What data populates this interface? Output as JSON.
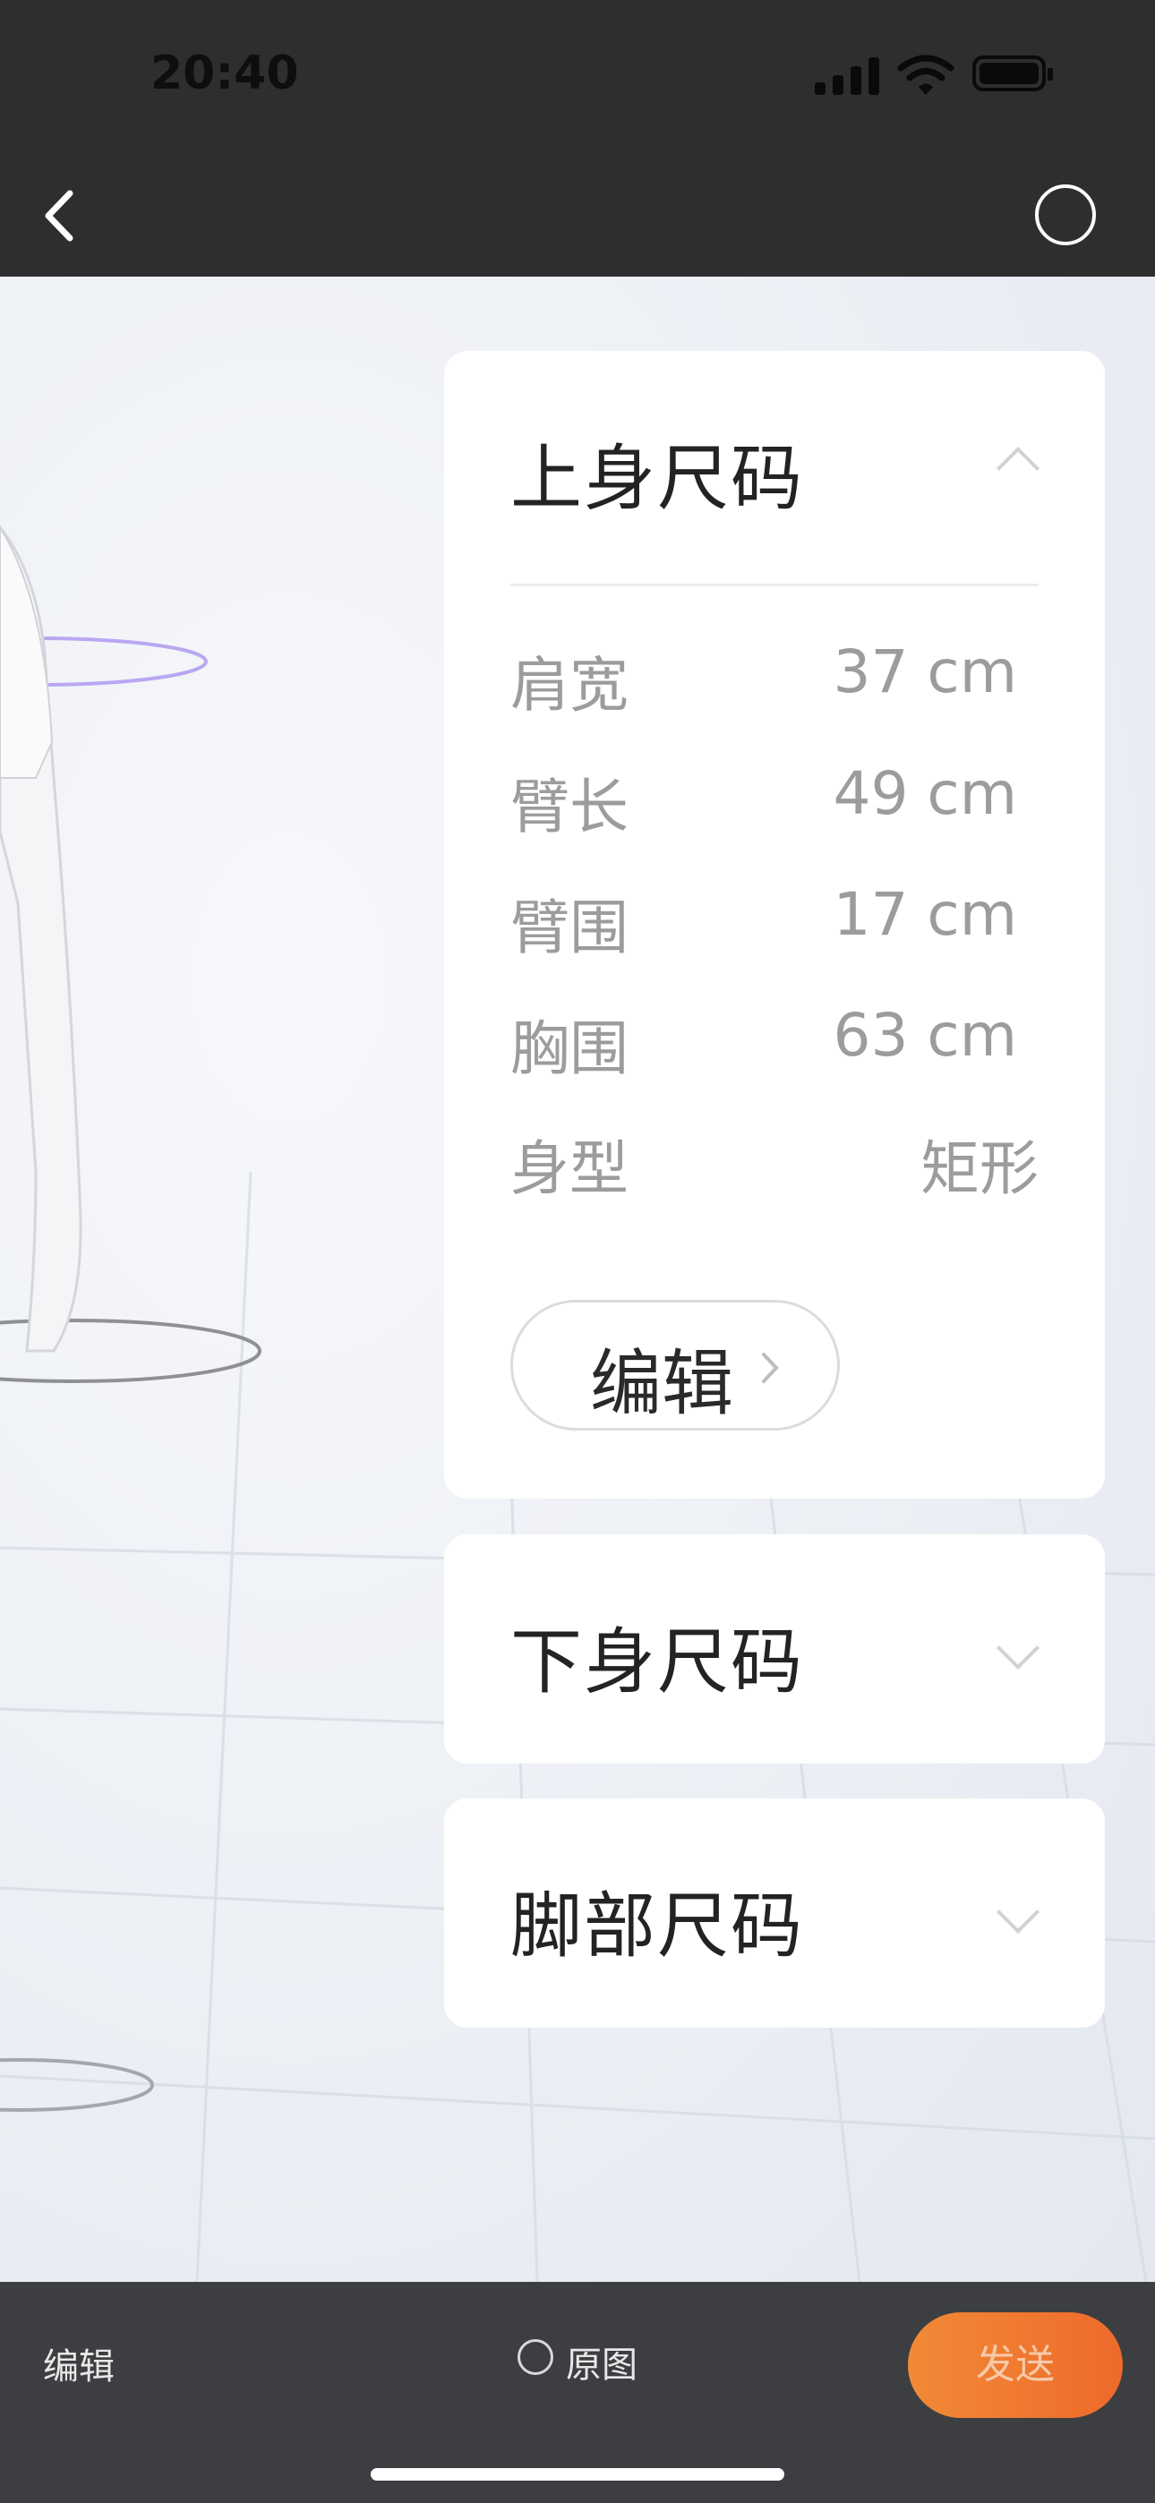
{
  "status_bar": {
    "time": "20:40"
  },
  "nav": {
    "back_icon": "chevron-left-icon",
    "right_icon": "circle-icon"
  },
  "upper_card": {
    "title": "上身尺码",
    "expanded": true,
    "rows": [
      {
        "label": "肩宽",
        "value": "37 cm"
      },
      {
        "label": "臂长",
        "value": "49 cm"
      },
      {
        "label": "臂围",
        "value": "17 cm"
      },
      {
        "label": "胸围",
        "value": "63 cm"
      },
      {
        "label": "身型",
        "value": "矩形"
      }
    ],
    "edit_label": "编辑"
  },
  "lower_card": {
    "title": "下身尺码",
    "expanded": false
  },
  "foot_card": {
    "title": "脚部尺码",
    "expanded": false
  },
  "bottom_bar": {
    "edit_label": "编辑",
    "original_label": "原图",
    "send_label": "发送"
  },
  "colors": {
    "accent": "#ee6a2a",
    "top_bar": "#2e2e30",
    "bottom_bar": "#3d3e41"
  }
}
